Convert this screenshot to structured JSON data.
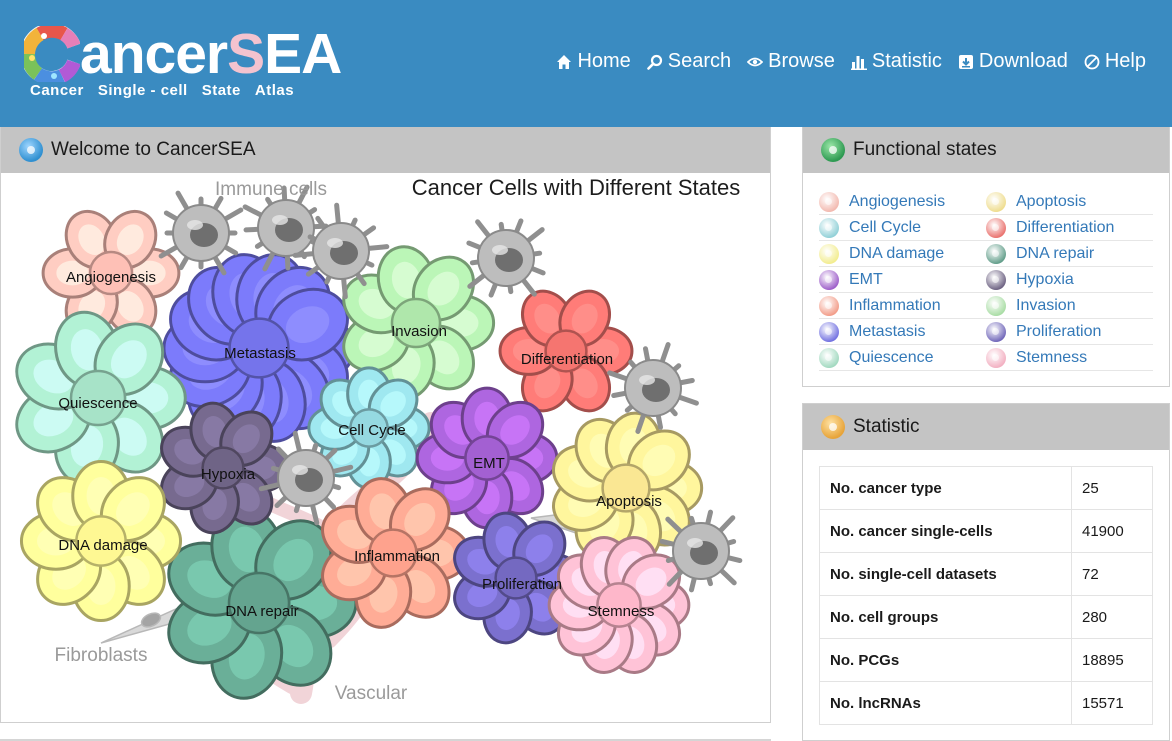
{
  "header": {
    "logo": {
      "main": "ancer",
      "s": "S",
      "end": "EA",
      "sub": [
        "Cancer",
        "Single - cell",
        "State",
        "Atlas"
      ]
    },
    "nav": [
      {
        "label": "Home",
        "icon": "home-icon"
      },
      {
        "label": "Search",
        "icon": "search-icon"
      },
      {
        "label": "Browse",
        "icon": "eye-icon"
      },
      {
        "label": "Statistic",
        "icon": "bar-chart-icon"
      },
      {
        "label": "Download",
        "icon": "download-icon"
      },
      {
        "label": "Help",
        "icon": "help-icon"
      }
    ]
  },
  "welcome": {
    "title": "Welcome to CancerSEA",
    "illustration": {
      "title": "Cancer Cells with Different States",
      "labels": {
        "immune": "Immune cells",
        "fibroblasts": "Fibroblasts",
        "vascular": "Vascular",
        "angiogenesis": "Angiogenesis",
        "metastasis": "Metastasis",
        "invasion": "Invasion",
        "differentiation": "Differentiation",
        "quiescence": "Quiescence",
        "cellcycle": "Cell Cycle",
        "emt": "EMT",
        "hypoxia": "Hypoxia",
        "apoptosis": "Apoptosis",
        "dnadamage": "DNA damage",
        "inflammation": "Inflammation",
        "proliferation": "Proliferation",
        "stemness": "Stemness",
        "dnarepair": "DNA repair"
      }
    }
  },
  "functional": {
    "title": "Functional states",
    "states": [
      {
        "label": "Angiogenesis",
        "color": "#f2b7ad"
      },
      {
        "label": "Apoptosis",
        "color": "#eedc8c"
      },
      {
        "label": "Cell Cycle",
        "color": "#8ecfd6"
      },
      {
        "label": "Differentiation",
        "color": "#e96f6b"
      },
      {
        "label": "DNA damage",
        "color": "#f2ec8c"
      },
      {
        "label": "DNA repair",
        "color": "#5f9c88"
      },
      {
        "label": "EMT",
        "color": "#9b5bc8"
      },
      {
        "label": "Hypoxia",
        "color": "#6a5f80"
      },
      {
        "label": "Inflammation",
        "color": "#f29a86"
      },
      {
        "label": "Invasion",
        "color": "#a7dca3"
      },
      {
        "label": "Metastasis",
        "color": "#6f6ee0"
      },
      {
        "label": "Proliferation",
        "color": "#6e64b8"
      },
      {
        "label": "Quiescence",
        "color": "#9fd8be"
      },
      {
        "label": "Stemness",
        "color": "#f2aec0"
      }
    ]
  },
  "statistic": {
    "title": "Statistic",
    "rows": [
      {
        "key": "No. cancer type",
        "value": "25"
      },
      {
        "key": "No. cancer single-cells",
        "value": "41900"
      },
      {
        "key": "No. single-cell datasets",
        "value": "72"
      },
      {
        "key": "No. cell groups",
        "value": "280"
      },
      {
        "key": "No. PCGs",
        "value": "18895"
      },
      {
        "key": "No. lncRNAs",
        "value": "15571"
      }
    ]
  },
  "colors": {
    "navbar": "#3a8bc1",
    "panel_header": "#c4c4c4",
    "link": "#3479b8",
    "bullet_welcome": "#2f8fd0",
    "bullet_functional": "#2e9a52",
    "bullet_statistic": "#e7a43a"
  }
}
